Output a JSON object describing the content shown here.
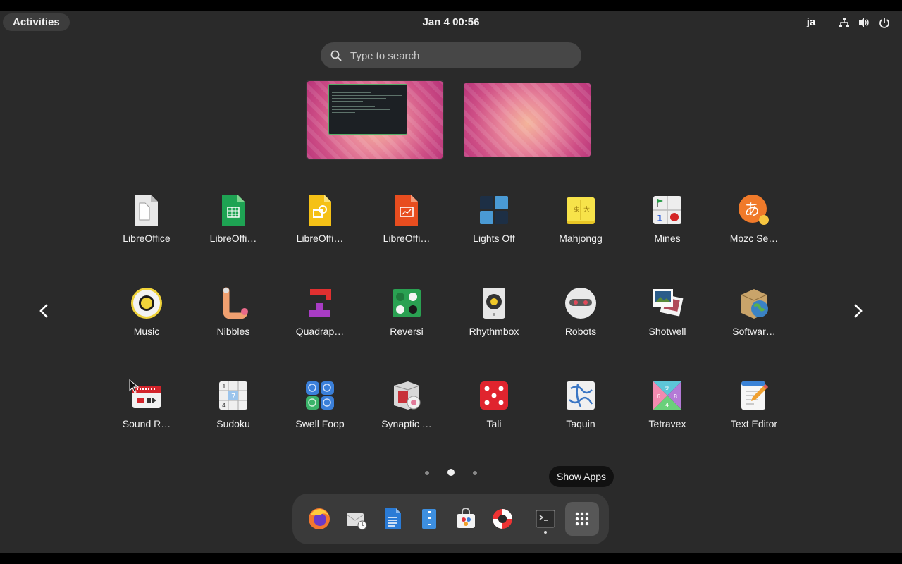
{
  "top_bar": {
    "activities_label": "Activities",
    "clock": "Jan 4  00:56",
    "input_method": "ja",
    "tray_icons": [
      "network-icon",
      "volume-icon",
      "power-icon"
    ]
  },
  "search": {
    "placeholder": "Type to search",
    "value": ""
  },
  "workspaces": [
    {
      "name": "workspace-1",
      "has_window": true
    },
    {
      "name": "workspace-2",
      "has_window": false
    }
  ],
  "apps": [
    {
      "label": "LibreOffice",
      "icon": "libreoffice-icon"
    },
    {
      "label": "LibreOffi…",
      "icon": "libreoffice-calc-icon"
    },
    {
      "label": "LibreOffi…",
      "icon": "libreoffice-draw-icon"
    },
    {
      "label": "LibreOffi…",
      "icon": "libreoffice-impress-icon"
    },
    {
      "label": "Lights Off",
      "icon": "lights-off-icon"
    },
    {
      "label": "Mahjongg",
      "icon": "mahjongg-icon"
    },
    {
      "label": "Mines",
      "icon": "mines-icon"
    },
    {
      "label": "Mozc Se…",
      "icon": "mozc-icon"
    },
    {
      "label": "Music",
      "icon": "music-icon"
    },
    {
      "label": "Nibbles",
      "icon": "nibbles-icon"
    },
    {
      "label": "Quadrap…",
      "icon": "quadrapassel-icon"
    },
    {
      "label": "Reversi",
      "icon": "reversi-icon"
    },
    {
      "label": "Rhythmbox",
      "icon": "rhythmbox-icon"
    },
    {
      "label": "Robots",
      "icon": "robots-icon"
    },
    {
      "label": "Shotwell",
      "icon": "shotwell-icon"
    },
    {
      "label": "Softwar…",
      "icon": "software-properties-icon"
    },
    {
      "label": "Sound R…",
      "icon": "sound-recorder-icon"
    },
    {
      "label": "Sudoku",
      "icon": "sudoku-icon"
    },
    {
      "label": "Swell Foop",
      "icon": "swell-foop-icon"
    },
    {
      "label": "Synaptic …",
      "icon": "synaptic-icon"
    },
    {
      "label": "Tali",
      "icon": "tali-icon"
    },
    {
      "label": "Taquin",
      "icon": "taquin-icon"
    },
    {
      "label": "Tetravex",
      "icon": "tetravex-icon"
    },
    {
      "label": "Text Editor",
      "icon": "text-editor-icon"
    }
  ],
  "pagination": {
    "pages": 3,
    "current": 2
  },
  "tooltip": "Show Apps",
  "dock": [
    {
      "name": "firefox",
      "icon": "firefox-icon",
      "running": false
    },
    {
      "name": "mail",
      "icon": "mail-icon",
      "running": false
    },
    {
      "name": "writer",
      "icon": "libreoffice-writer-icon",
      "running": false
    },
    {
      "name": "files",
      "icon": "files-icon",
      "running": false
    },
    {
      "name": "software",
      "icon": "software-center-icon",
      "running": false
    },
    {
      "name": "help",
      "icon": "help-icon",
      "running": false
    },
    {
      "name": "terminal",
      "icon": "terminal-icon",
      "running": true
    },
    {
      "name": "show-apps",
      "icon": "app-grid-icon",
      "running": false
    }
  ]
}
